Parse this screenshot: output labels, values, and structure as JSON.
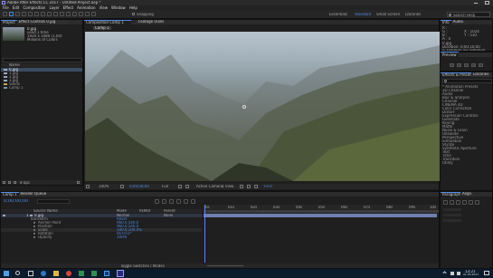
{
  "window": {
    "title": "Adobe After Effects CC 2017 - Untitled Project.aep *"
  },
  "menu": [
    "File",
    "Edit",
    "Composition",
    "Layer",
    "Effect",
    "Animation",
    "View",
    "Window",
    "Help"
  ],
  "toolbar": {
    "snapping_label": "Snapping",
    "workspaces": [
      "Essentials",
      "Standard",
      "Small Screen",
      "Libraries"
    ],
    "search_placeholder": "Search Help"
  },
  "project": {
    "tab_label": "Project",
    "item_name": "0.jpg",
    "item_info": [
      "used 1 time",
      "1920 x 1080 (1.00)"
    ],
    "item_depth": "Millions of Colors",
    "search_placeholder": "",
    "col_name": "Name",
    "items": [
      "0.jpg",
      "1.jpg",
      "2.jpg",
      "3.jpg",
      "Solids",
      "Comp 1"
    ],
    "bpc": "8 bpc"
  },
  "effect_controls": {
    "tab_label": "Effect Controls 0.jpg"
  },
  "composition": {
    "tab_label": "Composition Comp 1",
    "footage_tab": "Footage (none)",
    "breadcrumb": "Comp 1",
    "zoom": "100%",
    "timecode": "0;00;00;00",
    "quality": "Full",
    "camera": "Active Camera",
    "views": "1 View",
    "exposure": "+0.0"
  },
  "info": {
    "tab_label": "Info",
    "audio_tab": "Audio",
    "lines": [
      "R :",
      "G :",
      "B :",
      "A : 0",
      "X : 1024",
      "Y : 510"
    ],
    "extra": [
      "0.jpg",
      "Duration: 0;00;10;00",
      "In: 0;00;00;00, Out: 0;00;09;29"
    ]
  },
  "preview": {
    "tab_label": "Preview"
  },
  "effects_presets": {
    "tab_label": "Effects & Presets",
    "libraries_tab": "Libraries",
    "search_placeholder": "",
    "items": [
      "* Animation Presets",
      "3D Channel",
      "Audio",
      "Blur & Sharpen",
      "Channel",
      "CINEMA 4D",
      "Color Correction",
      "Distort",
      "Expression Controls",
      "Generate",
      "Keying",
      "Matte",
      "Noise & Grain",
      "Obsolete",
      "Perspective",
      "Simulation",
      "Stylize",
      "Synthetic Aperture",
      "Text",
      "Time",
      "Transition",
      "Utility"
    ]
  },
  "timeline": {
    "tab_label": "Comp 1",
    "render_queue_tab": "Render Queue",
    "timecode": "0;00;00;00",
    "col_source": "Source Name",
    "col_mode": "Mode",
    "col_trkmat": "TrkMat",
    "col_parent": "Parent",
    "layer_num": "1",
    "layer_name": "0.jpg",
    "layer_mode": "Normal",
    "layer_parent": "None",
    "transform_label": "Transform",
    "reset_label": "Reset",
    "props": [
      {
        "name": "Anchor Point",
        "value": "960.0,540.0"
      },
      {
        "name": "Position",
        "value": "960.0,540.0"
      },
      {
        "name": "Scale",
        "value": "100.0,100.0%"
      },
      {
        "name": "Rotation",
        "value": "0x+0.0°"
      },
      {
        "name": "Opacity",
        "value": "100%"
      }
    ],
    "ruler": [
      "0s",
      "01s",
      "02s",
      "03s",
      "04s",
      "05s",
      "06s",
      "07s",
      "08s",
      "09s",
      "10s"
    ],
    "toggle_label": "Toggle Switches / Modes"
  },
  "paragraph": {
    "tab_label": "Paragraph",
    "align_tab": "Align"
  },
  "taskbar": {
    "time": "13:21",
    "date": "01.05.2017"
  },
  "colors": {
    "accent": "#4f8ce6",
    "timebar": "#6f7fb0",
    "taskbar": "#0c1b2c"
  }
}
